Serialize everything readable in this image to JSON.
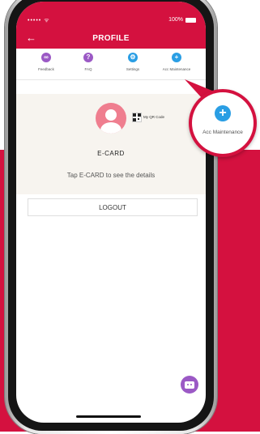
{
  "status_bar": {
    "carrier": "•••••  ᯤ",
    "battery": "100%"
  },
  "header": {
    "title": "PROFILE",
    "back_glyph": "←"
  },
  "tabs": [
    {
      "label": "Feedback",
      "icon": "feedback-icon",
      "color": "#9b59c5",
      "glyph": "∞"
    },
    {
      "label": "FAQ",
      "icon": "faq-icon",
      "color": "#9b59c5",
      "glyph": "?"
    },
    {
      "label": "Settings",
      "icon": "gear-icon",
      "color": "#2a9ee4",
      "glyph": "⚙"
    },
    {
      "label": "Acc Maintenance",
      "icon": "plus-icon",
      "color": "#2a9ee4",
      "glyph": "+"
    }
  ],
  "ecard": {
    "qr_label": "My QR Code",
    "title": "E-CARD",
    "subtitle": "Tap E-CARD to see the details"
  },
  "logout_label": "LOGOUT",
  "callout": {
    "label": "Acc Maintenance",
    "glyph": "+"
  },
  "colors": {
    "brand": "#d4113f",
    "purple": "#9b59c5",
    "blue": "#2a9ee4"
  }
}
